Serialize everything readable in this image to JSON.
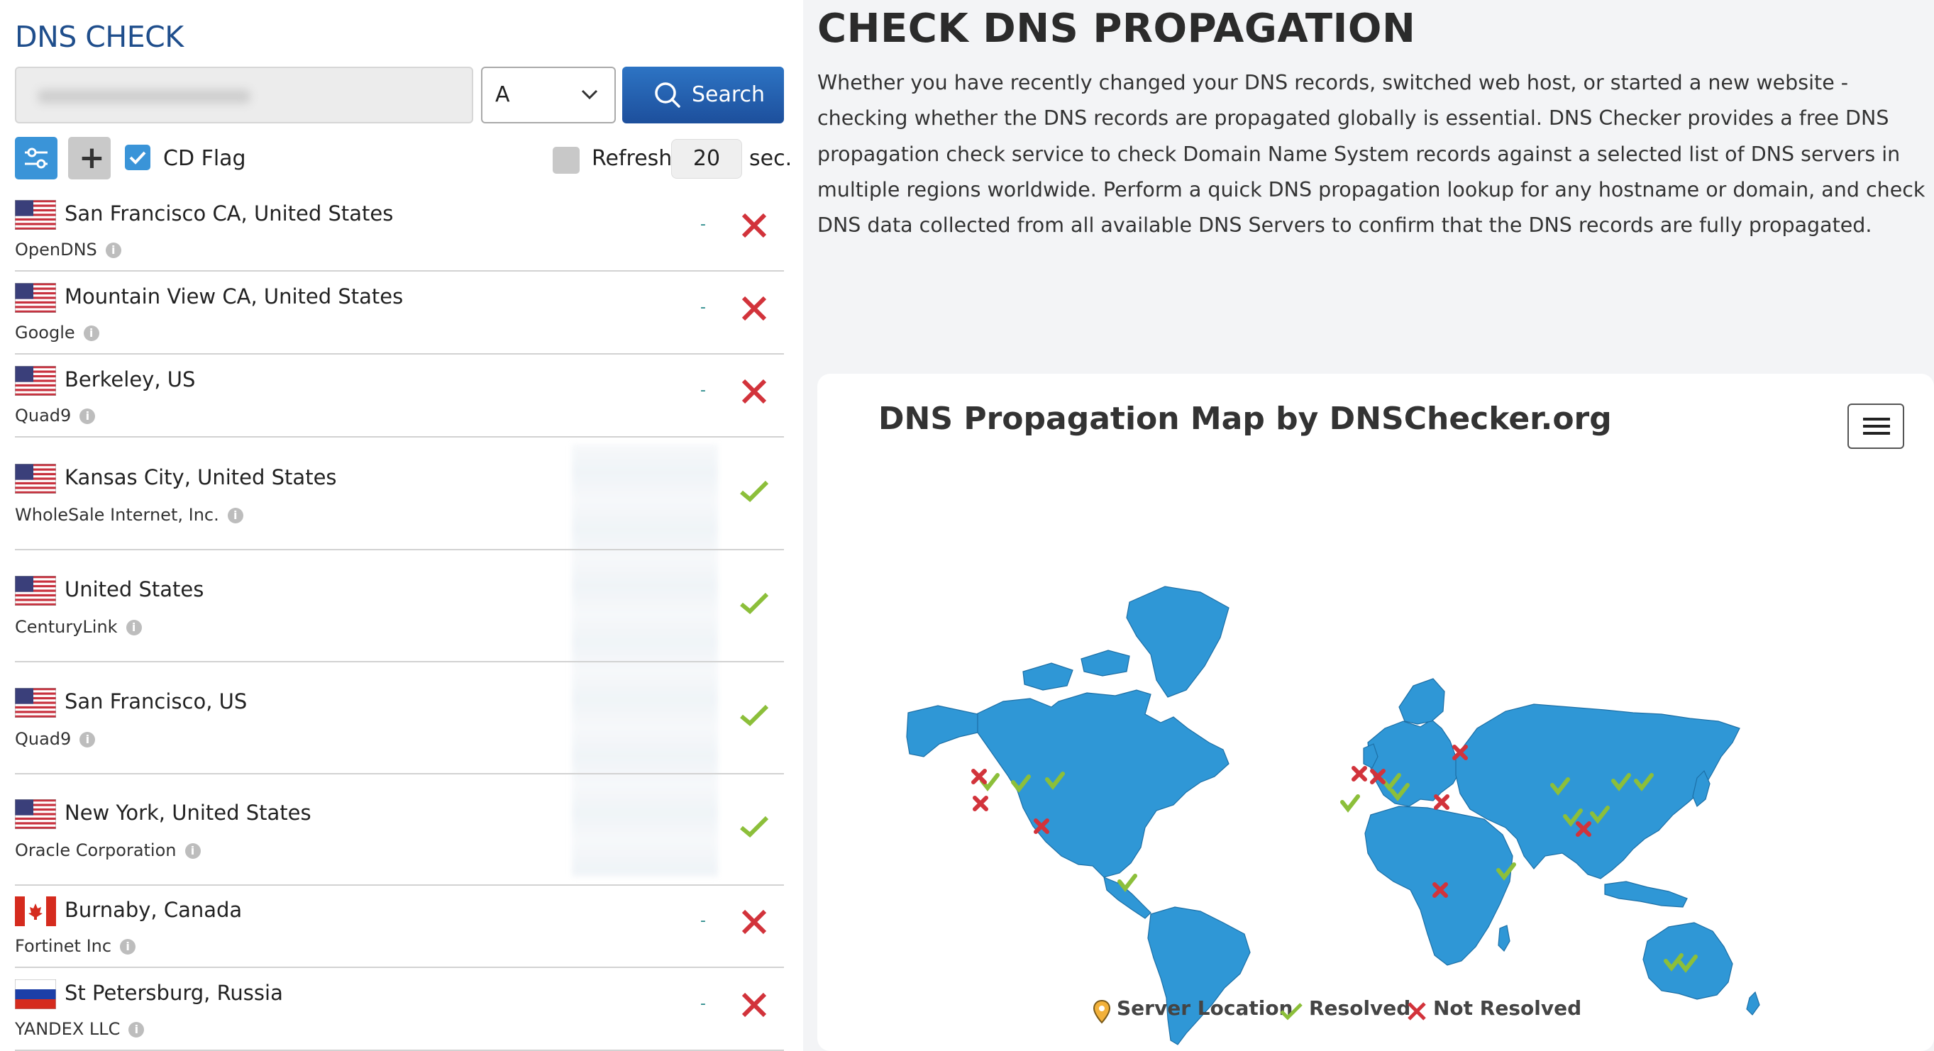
{
  "left": {
    "title": "DNS CHECK",
    "record_type": "A",
    "search_label": "Search",
    "cd_flag_label": "CD Flag",
    "cd_flag_checked": true,
    "refresh_label": "Refresh:",
    "refresh_value": "20",
    "refresh_unit": "sec."
  },
  "servers": [
    {
      "location": "San Francisco CA, United States",
      "provider": "OpenDNS",
      "country": "us",
      "result": "-",
      "status": "not-resolved"
    },
    {
      "location": "Mountain View CA, United States",
      "provider": "Google",
      "country": "us",
      "result": "-",
      "status": "not-resolved"
    },
    {
      "location": "Berkeley, US",
      "provider": "Quad9",
      "country": "us",
      "result": "-",
      "status": "not-resolved"
    },
    {
      "location": "Kansas City, United States",
      "provider": "WholeSale Internet, Inc.",
      "country": "us",
      "result": "",
      "status": "resolved"
    },
    {
      "location": "United States",
      "provider": "CenturyLink",
      "country": "us",
      "result": "",
      "status": "resolved"
    },
    {
      "location": "San Francisco, US",
      "provider": "Quad9",
      "country": "us",
      "result": "",
      "status": "resolved"
    },
    {
      "location": "New York, United States",
      "provider": "Oracle Corporation",
      "country": "us",
      "result": "",
      "status": "resolved"
    },
    {
      "location": "Burnaby, Canada",
      "provider": "Fortinet Inc",
      "country": "ca",
      "result": "-",
      "status": "not-resolved"
    },
    {
      "location": "St Petersburg, Russia",
      "provider": "YANDEX LLC",
      "country": "ru",
      "result": "-",
      "status": "not-resolved"
    }
  ],
  "right": {
    "title": "CHECK DNS PROPAGATION",
    "description": "Whether you have recently changed your DNS records, switched web host, or started a new website - checking whether the DNS records are propagated globally is essential. DNS Checker provides a free DNS propagation check service to check Domain Name System records against a selected list of DNS servers in multiple regions worldwide. Perform a quick DNS propagation lookup for any hostname or domain, and check DNS data collected from all available DNS Servers to confirm that the DNS records are fully propagated."
  },
  "map": {
    "title": "DNS Propagation Map by DNSChecker.org",
    "legend": {
      "server_location": "Server Location",
      "resolved": "Resolved",
      "not_resolved": "Not Resolved"
    },
    "colors": {
      "land": "#2f97d6",
      "resolved": "#8cbf3a",
      "not_resolved": "#d2333b"
    }
  },
  "colors": {
    "accent": "#3a94d8",
    "search_button": "#1d4f9c",
    "title_blue": "#1f4e8c"
  }
}
